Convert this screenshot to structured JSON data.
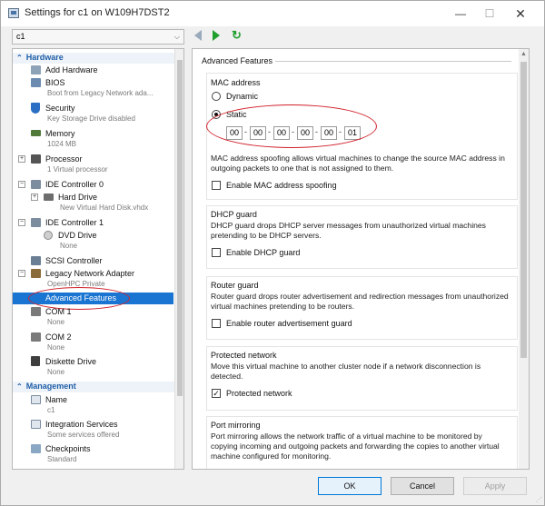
{
  "window": {
    "title": "Settings for c1 on W109H7DST2",
    "min_glyph": "—",
    "max_glyph": "☐",
    "close_glyph": "✕"
  },
  "toolbar": {
    "vm_selected": "c1",
    "vm_chevron": "⌵",
    "refresh_glyph": "↻"
  },
  "sidebar": {
    "hardware_heading": "Hardware",
    "management_heading": "Management",
    "section_glyph": "⌃",
    "items": [
      {
        "label": "Add Hardware",
        "sub": ""
      },
      {
        "label": "BIOS",
        "sub": "Boot from Legacy Network ada..."
      },
      {
        "label": "Security",
        "sub": "Key Storage Drive disabled"
      },
      {
        "label": "Memory",
        "sub": "1024 MB"
      },
      {
        "label": "Processor",
        "sub": "1 Virtual processor"
      },
      {
        "label": "IDE Controller 0",
        "sub": ""
      },
      {
        "label": "Hard Drive",
        "sub": "New Virtual Hard Disk.vhdx"
      },
      {
        "label": "IDE Controller 1",
        "sub": ""
      },
      {
        "label": "DVD Drive",
        "sub": "None"
      },
      {
        "label": "SCSI Controller",
        "sub": ""
      },
      {
        "label": "Legacy Network Adapter",
        "sub": "OpenHPC Private"
      },
      {
        "label": "Advanced Features",
        "sub": ""
      },
      {
        "label": "COM 1",
        "sub": "None"
      },
      {
        "label": "COM 2",
        "sub": "None"
      },
      {
        "label": "Diskette Drive",
        "sub": "None"
      },
      {
        "label": "Name",
        "sub": "c1"
      },
      {
        "label": "Integration Services",
        "sub": "Some services offered"
      },
      {
        "label": "Checkpoints",
        "sub": "Standard"
      }
    ]
  },
  "panel": {
    "title": "Advanced Features",
    "mac": {
      "title": "MAC address",
      "dynamic_label": "Dynamic",
      "static_label": "Static",
      "selected": "Static",
      "octets": [
        "00",
        "00",
        "00",
        "00",
        "00",
        "01"
      ],
      "spoof_text": "MAC address spoofing allows virtual machines to change the source MAC address in outgoing packets to one that is not assigned to them.",
      "spoof_label": "Enable MAC address spoofing",
      "spoof_checked": false
    },
    "dhcp": {
      "title": "DHCP guard",
      "text": "DHCP guard drops DHCP server messages from unauthorized virtual machines pretending to be DHCP servers.",
      "label": "Enable DHCP guard",
      "checked": false
    },
    "router": {
      "title": "Router guard",
      "text": "Router guard drops router advertisement and redirection messages from unauthorized virtual machines pretending to be routers.",
      "label": "Enable router advertisement guard",
      "checked": false
    },
    "protected": {
      "title": "Protected network",
      "text": "Move this virtual machine to another cluster node if a network disconnection is detected.",
      "label": "Protected network",
      "checked": true,
      "check_glyph": "✓"
    },
    "mirroring": {
      "title": "Port mirroring",
      "text": "Port mirroring allows the network traffic of a virtual machine to be monitored by copying incoming and outgoing packets and forwarding the copies to another virtual machine configured for monitoring."
    }
  },
  "buttons": {
    "ok": "OK",
    "cancel": "Cancel",
    "apply": "Apply"
  },
  "colors": {
    "selection": "#1a75d2",
    "section_heading": "#1f5ea8",
    "annotation": "#d0202a",
    "nav_green": "#1e9e2c"
  }
}
